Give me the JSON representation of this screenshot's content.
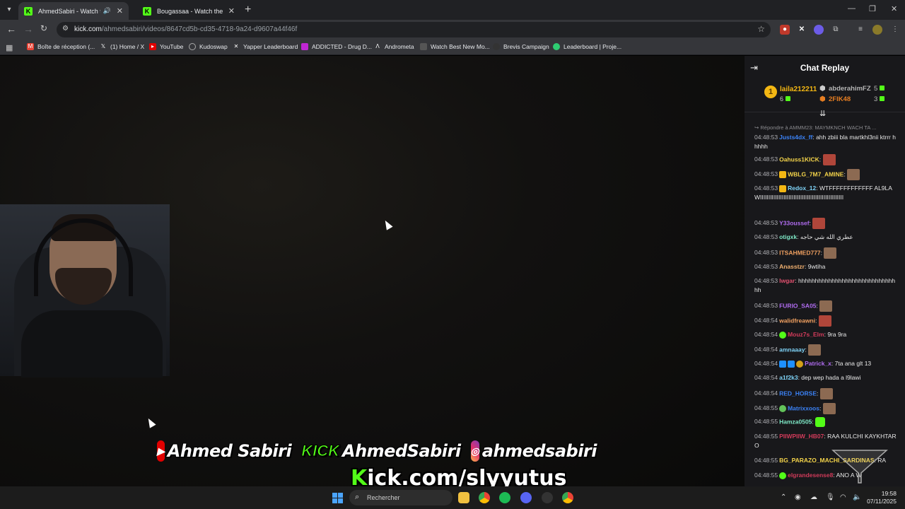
{
  "browser": {
    "tabs": [
      {
        "title": "AhmedSabiri - Watch the V",
        "active": true
      },
      {
        "title": "Bougassaa - Watch the VOD on",
        "active": false
      }
    ],
    "url_domain": "kick.com",
    "url_path": "/ahmedsabiri/videos/8647cd5b-cd35-4718-9a24-d9607a44f46f",
    "bookmarks": [
      "Boîte de réception (...",
      "(1) Home / X",
      "YouTube",
      "Kudoswap",
      "Yapper Leaderboard",
      "ADDICTED - Drug D...",
      "Andrometa",
      "Watch Best New Mo...",
      "Brevis Campaign",
      "Leaderboard | Proje..."
    ]
  },
  "stream_overlay": {
    "youtube_logo": "▶",
    "youtube_name": "Ahmed Sabiri",
    "kick_logo": "KICK",
    "kick_name": "AhmedSabiri",
    "instagram_logo": "◎",
    "instagram_name": "ahmedsabiri",
    "kick_url_k": "K",
    "kick_url_rest": "ick.com/slyyutus"
  },
  "chat": {
    "title": "Chat Replay",
    "leaderboard": {
      "first": {
        "rank": "1",
        "name": "laila212211",
        "count": "6"
      },
      "second": {
        "name": "abderahimFZ",
        "count": "5"
      },
      "third": {
        "name": "2FIK48",
        "count": "3"
      }
    },
    "reply_hint": "↪ Répondre à AMMM23: MAYMKNCH WACH TA ...",
    "messages": [
      {
        "time": "04:48:53",
        "user": "Justs4dx_ff",
        "color": "#3b82f6",
        "text": "ahh zbiii bla martkhl3nii ktrrr hhhhh"
      },
      {
        "time": "04:48:53",
        "user": "Oahuss1KICK",
        "color": "#f3d34a",
        "text": ""
      },
      {
        "time": "04:48:53",
        "user": "WBLG_7M7_AMINE",
        "color": "#f3d34a",
        "text": ""
      },
      {
        "time": "04:48:53",
        "user": "Redox_12",
        "color": "#7fd3f7",
        "text": "WTFFFFFFFFFFFF AL9LAWIIIIIIIIIIIIIIIIIIIIIIIIIIIIIIIIIIIIIIIIIIIIIIIIII"
      },
      {
        "time": "04:48:53",
        "user": "Y33oussef",
        "color": "#b06cf0",
        "text": ""
      },
      {
        "time": "04:48:53",
        "user": "otigxk",
        "color": "#7ee8c6",
        "text": "عطري الله شي حاجه"
      },
      {
        "time": "04:48:53",
        "user": "ITSAHMED777",
        "color": "#f0a060",
        "text": ""
      },
      {
        "time": "04:48:53",
        "user": "Anasstzr",
        "color": "#f0b070",
        "text": "9wtiha"
      },
      {
        "time": "04:48:53",
        "user": "lwgar",
        "color": "#e0506e",
        "text": "hhhhhhhhhhhhhhhhhhhhhhhhhhhhhhh"
      },
      {
        "time": "04:48:53",
        "user": "FURIO_SA05",
        "color": "#b06cf0",
        "text": ""
      },
      {
        "time": "04:48:54",
        "user": "walidfreawni",
        "color": "#f0a060",
        "text": ""
      },
      {
        "time": "04:48:54",
        "user": "Mouz7s_Elm",
        "color": "#d13b5a",
        "text": "9ra 9ra"
      },
      {
        "time": "04:48:54",
        "user": "amnaaay",
        "color": "#7fd3f7",
        "text": ""
      },
      {
        "time": "04:48:54",
        "user": "Patrick_x",
        "color": "#b06cf0",
        "text": "7ta ana glt 13"
      },
      {
        "time": "04:48:54",
        "user": "a1f2k3",
        "color": "#7fd3f7",
        "text": "dep wep hada a l9lawi"
      },
      {
        "time": "04:48:54",
        "user": "RED_HORSE",
        "color": "#3b82f6",
        "text": ""
      },
      {
        "time": "04:48:55",
        "user": "Matrixxoos",
        "color": "#3b82f6",
        "text": ""
      },
      {
        "time": "04:48:55",
        "user": "Hamza0505",
        "color": "#7ee8c6",
        "text": ""
      },
      {
        "time": "04:48:55",
        "user": "PIIWPIIW_HB07",
        "color": "#d13b5a",
        "text": "RAA KULCHI KAYKHTARO"
      },
      {
        "time": "04:48:55",
        "user": "BG_PARAZO_MACHI_SARDINAS",
        "color": "#f3d34a",
        "text": "RA"
      },
      {
        "time": "04:48:55",
        "user": "elgrandesense8",
        "color": "#d13b5a",
        "text": "ANO A W"
      }
    ]
  },
  "taskbar": {
    "search_placeholder": "Rechercher",
    "time": "19:58",
    "date": "07/11/2025"
  }
}
